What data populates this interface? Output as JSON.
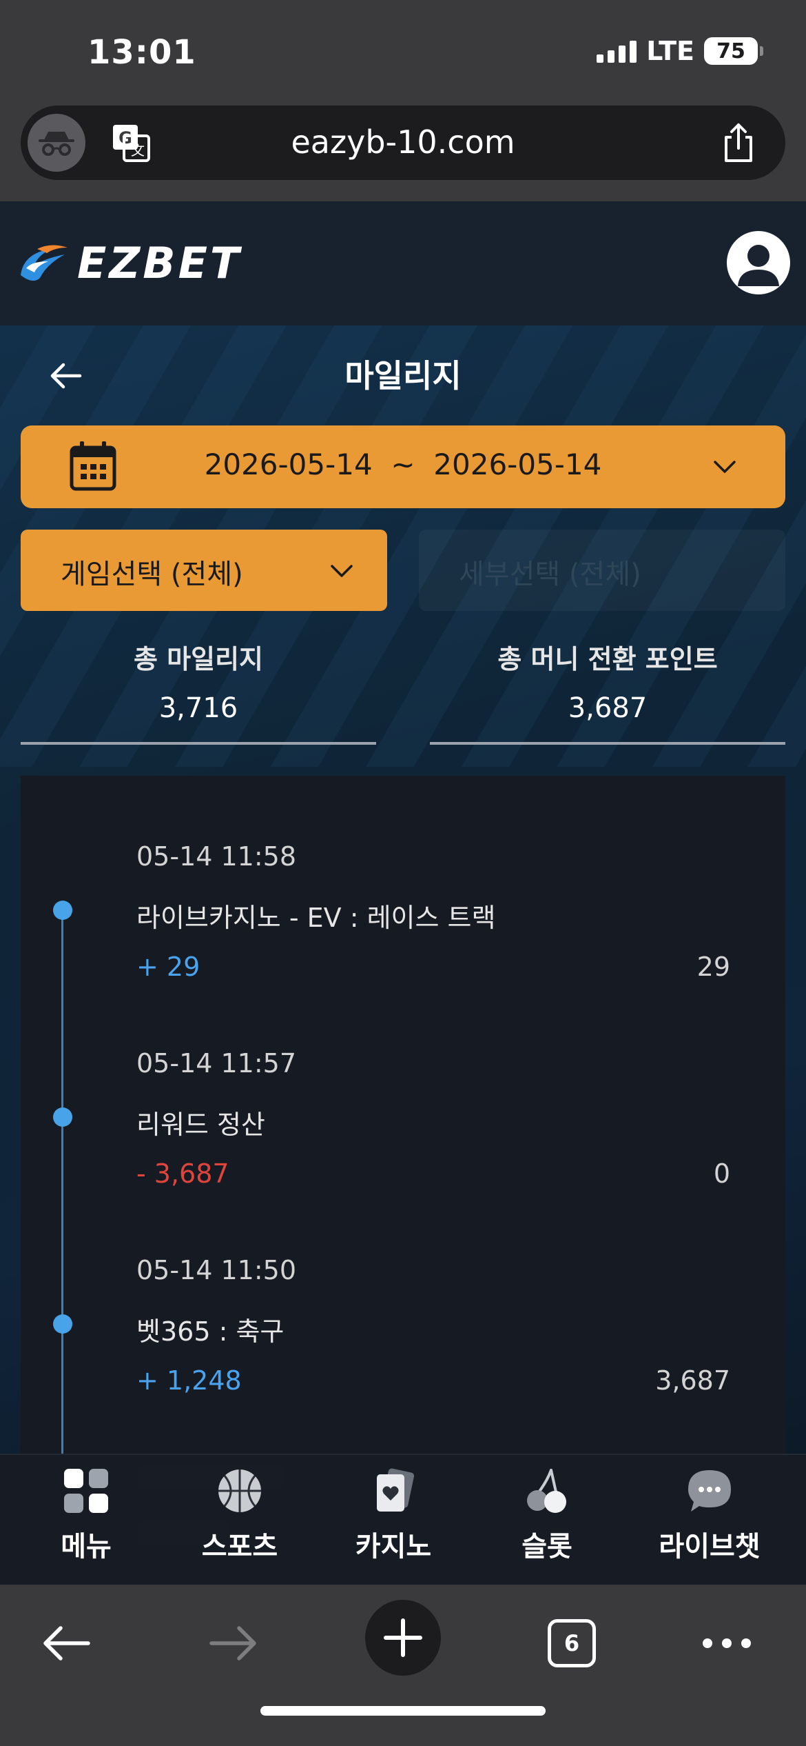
{
  "status_bar": {
    "time": "13:01",
    "network": "LTE",
    "battery": "75"
  },
  "browser": {
    "url": "eazyb-10.com",
    "tab_count": "6"
  },
  "header": {
    "logo_text": "EZBET"
  },
  "page": {
    "title": "마일리지"
  },
  "filters": {
    "date_range": "2026-05-14  ~  2026-05-14",
    "game_select": "게임선택 (전체)",
    "sub_select": "세부선택 (전체)"
  },
  "stats": {
    "total_mileage_label": "총 마일리지",
    "total_mileage_value": "3,716",
    "total_conversion_label": "총 머니 전환 포인트",
    "total_conversion_value": "3,687"
  },
  "entries": [
    {
      "time": "05-14 11:58",
      "desc": "라이브카지노 - EV : 레이스 트랙",
      "amount": "+ 29",
      "balance": "29"
    },
    {
      "time": "05-14 11:57",
      "desc": "리워드 정산",
      "amount": "- 3,687",
      "balance": "0"
    },
    {
      "time": "05-14 11:50",
      "desc": "벳365 : 축구",
      "amount": "+ 1,248",
      "balance": "3,687"
    }
  ],
  "bottom_nav": [
    {
      "label": "메뉴",
      "icon": "menu-grid-icon"
    },
    {
      "label": "스포츠",
      "icon": "basketball-icon"
    },
    {
      "label": "카지노",
      "icon": "cards-icon"
    },
    {
      "label": "슬롯",
      "icon": "cherry-icon"
    },
    {
      "label": "라이브챗",
      "icon": "chat-bubble-icon"
    }
  ],
  "colors": {
    "accent": "#EA9A34",
    "plus": "#4AA3EE",
    "minus": "#E0453C",
    "timeline": "#48A3E8"
  }
}
